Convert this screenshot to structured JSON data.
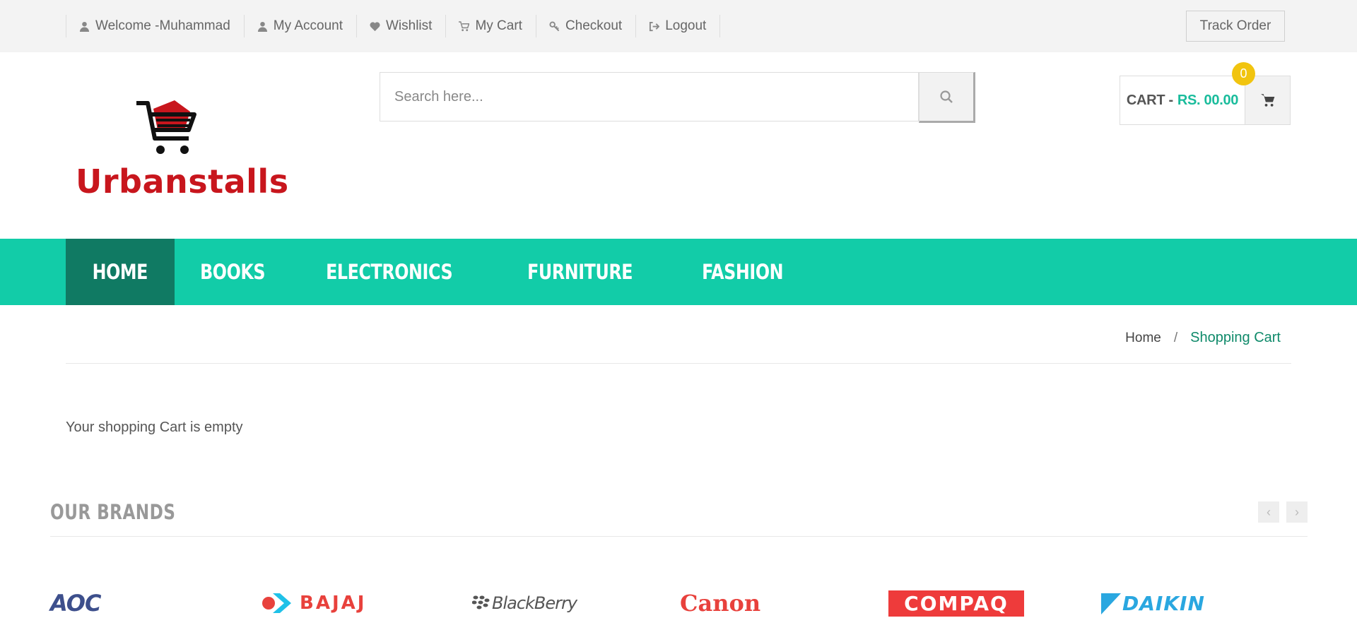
{
  "topbar": {
    "links": [
      {
        "label": "Welcome -Muhammad",
        "icon": "user-icon"
      },
      {
        "label": "My Account",
        "icon": "user-icon"
      },
      {
        "label": "Wishlist",
        "icon": "heart-icon"
      },
      {
        "label": "My Cart",
        "icon": "cart-icon"
      },
      {
        "label": "Checkout",
        "icon": "key-icon"
      },
      {
        "label": "Logout",
        "icon": "logout-icon"
      }
    ],
    "track_order": "Track Order"
  },
  "logo": {
    "text": "Urbanstalls",
    "color": "#c8161d"
  },
  "search": {
    "placeholder": "Search here..."
  },
  "cart": {
    "label": "CART -",
    "amount": "RS. 00.00",
    "count": "0"
  },
  "nav": {
    "items": [
      "HOME",
      "BOOKS",
      "ELECTRONICS",
      "FURNITURE",
      "FASHION"
    ],
    "active": "HOME"
  },
  "breadcrumb": {
    "home": "Home",
    "separator": "/",
    "current": "Shopping Cart"
  },
  "message": "Your shopping Cart is empty",
  "brands": {
    "title": "OUR BRANDS",
    "prev": "‹",
    "next": "›",
    "logos": [
      "AOC",
      "BAJAJ",
      "BlackBerry",
      "Canon",
      "COMPAQ",
      "DAIKIN"
    ]
  },
  "colors": {
    "accent": "#12cca8",
    "accent_dark": "#107a63",
    "badge": "#f1c40f"
  }
}
